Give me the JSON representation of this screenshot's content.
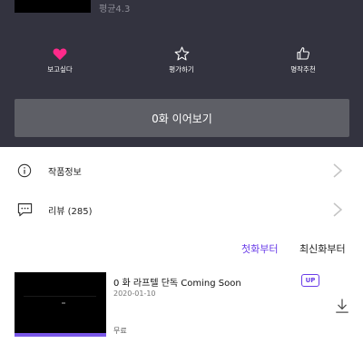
{
  "header": {
    "rating_text": "평균4.3"
  },
  "actions": [
    {
      "label": "보고싶다",
      "icon": "heart-icon",
      "color": "#ff2a8a"
    },
    {
      "label": "평가하기",
      "icon": "star-icon"
    },
    {
      "label": "명작추천",
      "icon": "thumbs-up-icon"
    }
  ],
  "continue_button": {
    "label": "0화 이어보기"
  },
  "menu": {
    "info": {
      "label": "작품정보",
      "icon": "info-icon"
    },
    "review": {
      "label": "리뷰 (285)",
      "icon": "comment-icon"
    }
  },
  "sort": {
    "first_label": "첫화부터",
    "latest_label": "최신화부터",
    "active_color": "#6a3de8"
  },
  "episodes": [
    {
      "title": "0 화 라프텔 단독 Coming Soon",
      "date": "2020-01-10",
      "price": "무료",
      "badge": "UP"
    }
  ],
  "colors": {
    "top_background": "#33333f",
    "continue_button": "#5e5f66",
    "accent": "#7a57e8"
  }
}
